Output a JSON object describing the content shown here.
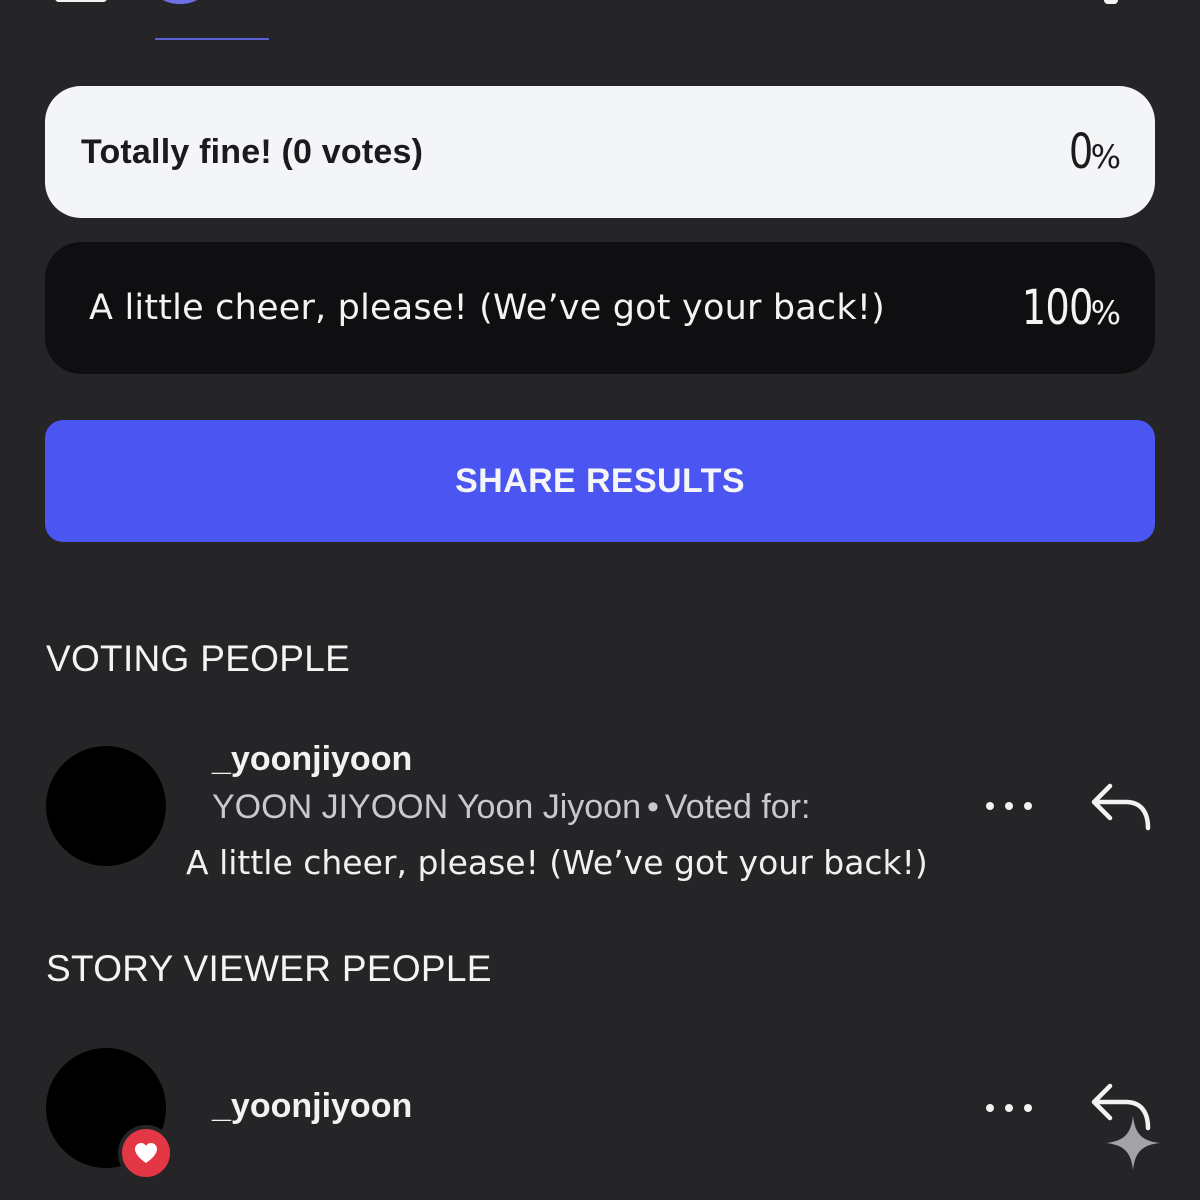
{
  "poll": {
    "options": [
      {
        "label": "Totally fine! (0 votes)",
        "percent_value": "0",
        "percent_sign": "%",
        "fill_fraction": 0
      },
      {
        "label": "A little cheer, please! (We’ve got your back!)",
        "percent_value": "100",
        "percent_sign": "%",
        "fill_fraction": 1
      }
    ]
  },
  "share_button": {
    "label": "SHARE RESULTS"
  },
  "voting": {
    "title": "VOTING PEOPLE",
    "voter": {
      "username": "_yoonjiyoon",
      "display_name": "YOON JIYOON Yoon Jiyoon",
      "separator": "•",
      "voted_for_label": "Voted for:",
      "voted_option": "A little cheer, please! (We’ve got your back!)"
    }
  },
  "viewers": {
    "title": "STORY VIEWER PEOPLE",
    "viewer": {
      "username": "_yoonjiyoon",
      "reaction": "heart-icon"
    }
  },
  "colors": {
    "background": "#252528",
    "accent": "#4a55f2",
    "heart": "#e43745"
  }
}
